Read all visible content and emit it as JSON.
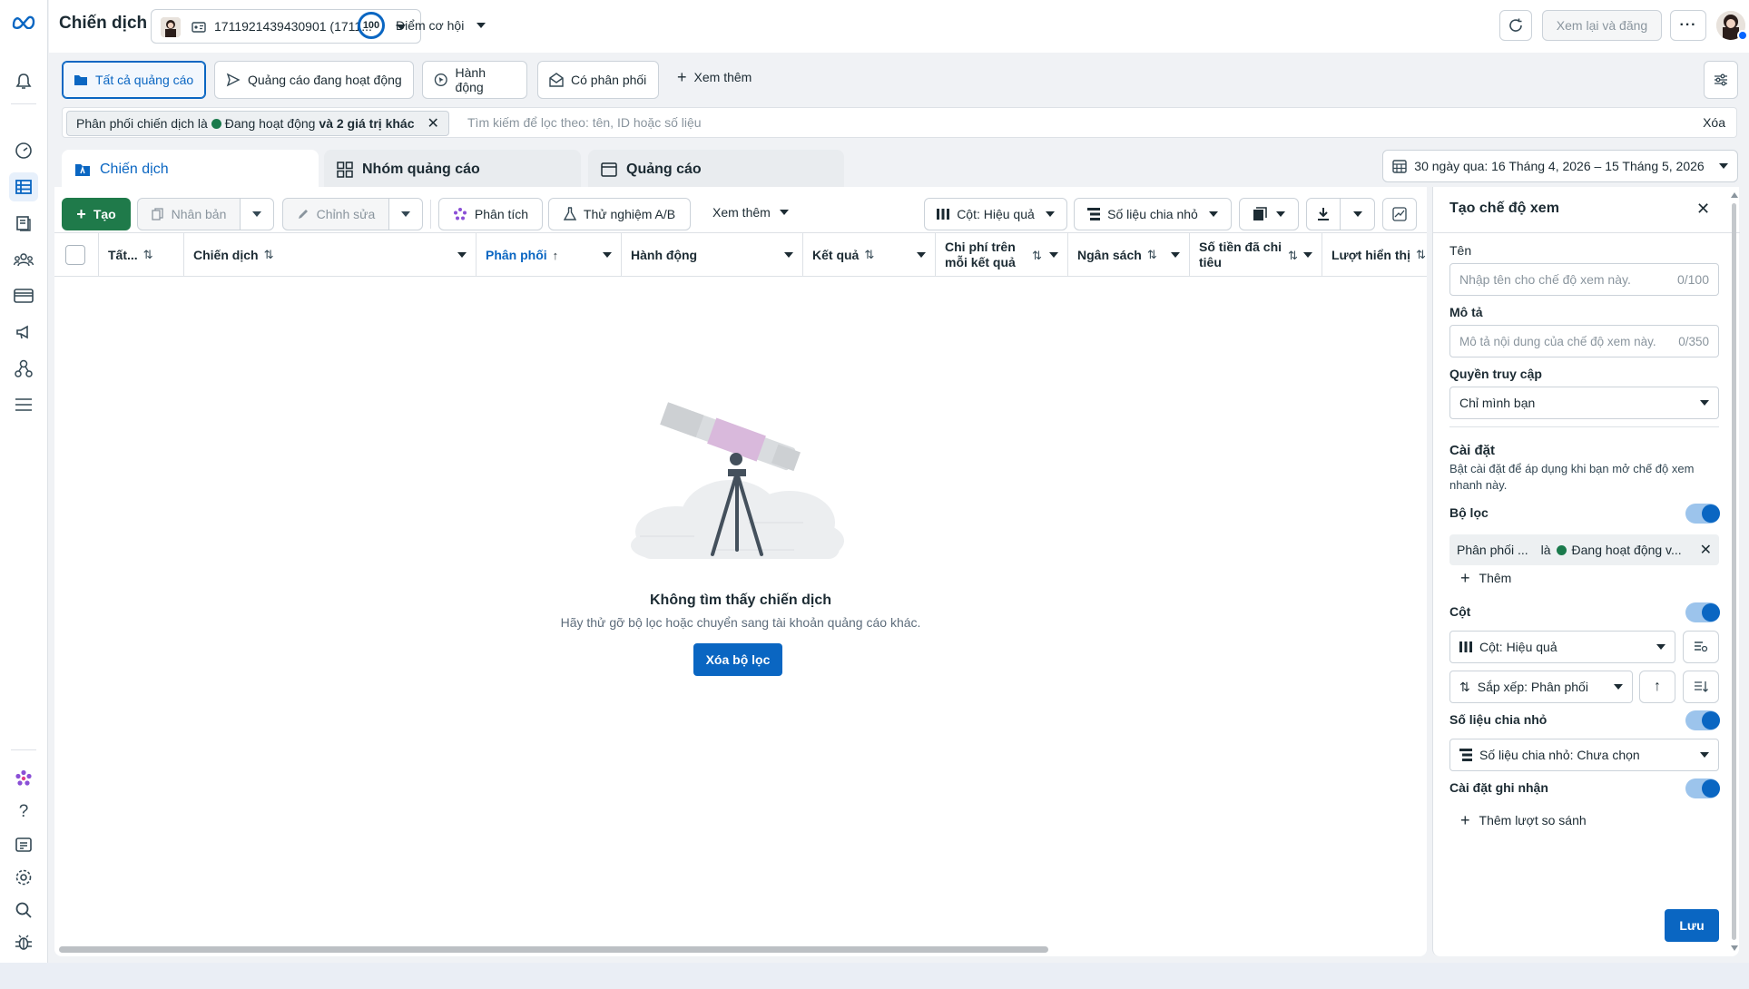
{
  "topbar": {
    "title": "Chiến dịch",
    "account_id": "1711921439430901 (1711...",
    "opportunity_score": "100",
    "opportunity_label": "Điểm cơ hội",
    "review_publish": "Xem lại và đăng"
  },
  "filter_tabs": {
    "all_ads": "Tất cả quảng cáo",
    "active_ads": "Quảng cáo đang hoạt động",
    "actions": "Hành động",
    "has_delivery": "Có phân phối",
    "see_more": "Xem thêm"
  },
  "search": {
    "chip_prefix": "Phân phối chiến dịch là",
    "chip_value": "Đang hoạt động",
    "chip_suffix": "và 2 giá trị khác",
    "placeholder": "Tìm kiếm để lọc theo: tên, ID hoặc số liệu",
    "clear": "Xóa"
  },
  "level_tabs": {
    "campaigns": "Chiến dịch",
    "ad_sets": "Nhóm quảng cáo",
    "ads": "Quảng cáo"
  },
  "date_range": "30 ngày qua: 16 Tháng 4, 2026 – 15 Tháng 5, 2026",
  "toolbar": {
    "create": "Tạo",
    "duplicate": "Nhân bản",
    "edit": "Chỉnh sửa",
    "analyze": "Phân tích",
    "ab_test": "Thử nghiệm A/B",
    "see_more": "Xem thêm",
    "columns": "Cột: Hiệu quả",
    "breakdown": "Số liệu chia nhỏ"
  },
  "table": {
    "headers": {
      "all": "Tất...",
      "campaign": "Chiến dịch",
      "delivery": "Phân phối",
      "actions": "Hành động",
      "results": "Kết quả",
      "cost_per_result_1": "Chi phí trên",
      "cost_per_result_2": "mỗi kết quả",
      "budget": "Ngân sách",
      "amount_spent_1": "Số tiền đã chi",
      "amount_spent_2": "tiêu",
      "impressions": "Lượt hiển thị"
    }
  },
  "empty": {
    "title": "Không tìm thấy chiến dịch",
    "subtitle": "Hãy thử gỡ bộ lọc hoặc chuyển sang tài khoản quảng cáo khác.",
    "clear_filters": "Xóa bộ lọc"
  },
  "panel": {
    "title": "Tạo chế độ xem",
    "name_label": "Tên",
    "name_placeholder": "Nhập tên cho chế độ xem này.",
    "name_counter": "0/100",
    "desc_label": "Mô tả",
    "desc_placeholder": "Mô tả nội dung của chế độ xem này.",
    "desc_counter": "0/350",
    "access_label": "Quyền truy cập",
    "access_value": "Chỉ mình bạn",
    "settings_title": "Cài đặt",
    "settings_desc": "Bật cài đặt để áp dụng khi bạn mở chế độ xem nhanh này.",
    "filter_label": "Bộ lọc",
    "filter_chip_field": "Phân phối ...",
    "filter_chip_op": "là",
    "filter_chip_value": "Đang hoạt động v...",
    "add": "Thêm",
    "columns_label": "Cột",
    "columns_value": "Cột: Hiệu quả",
    "sort_value": "Sắp xếp: Phân phối",
    "breakdown_label": "Số liệu chia nhỏ",
    "breakdown_value": "Số liệu chia nhỏ: Chưa chọn",
    "attribution_label": "Cài đặt ghi nhận",
    "add_comparison": "Thêm lượt so sánh",
    "save": "Lưu"
  },
  "colors": {
    "primary": "#0a66c2",
    "create_green": "#1f7a4a",
    "active_dot": "#1a7a4c"
  }
}
